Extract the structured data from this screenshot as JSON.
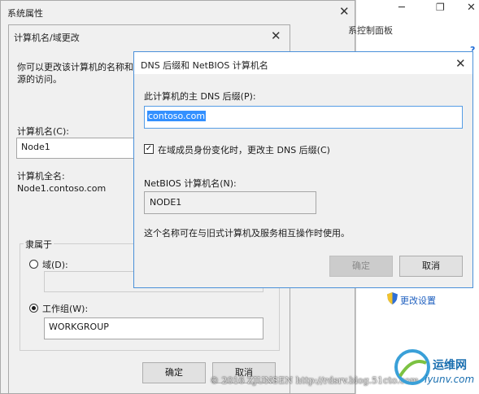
{
  "system_props": {
    "title": "系统属性"
  },
  "background_window": {
    "control_panel_text": "系控制面板",
    "help_icon": "?",
    "change_settings": "更改设置"
  },
  "rename_dialog": {
    "title": "计算机名/域更改",
    "intro": "你可以更改该计算机的名称和",
    "intro2": "源的访问。",
    "computer_name_label": "计算机名(C):",
    "computer_name_value": "Node1",
    "full_name_label": "计算机全名:",
    "full_name_value": "Node1.contoso.com",
    "member_of_label": "隶属于",
    "domain_label": "域(D):",
    "domain_value": "",
    "workgroup_label": "工作组(W):",
    "workgroup_value": "WORKGROUP",
    "ok_label": "确定",
    "cancel_label": "取消"
  },
  "dns_dialog": {
    "title": "DNS 后缀和 NetBIOS 计算机名",
    "primary_suffix_label": "此计算机的主 DNS 后缀(P):",
    "primary_suffix_value": "contoso.com",
    "change_suffix_checkbox": "在域成员身份变化时，更改主 DNS 后缀(C)",
    "netbios_label": "NetBIOS 计算机名(N):",
    "netbios_value": "NODE1",
    "note": "这个名称可在与旧式计算机及服务相互操作时使用。",
    "ok_label": "确定",
    "cancel_label": "取消"
  },
  "watermark": {
    "copyright": "© 2016 ZJUNSEN http://rdsrv.blog.51cto.com",
    "brand": "运维网",
    "brand_url": "iyunv.com"
  }
}
